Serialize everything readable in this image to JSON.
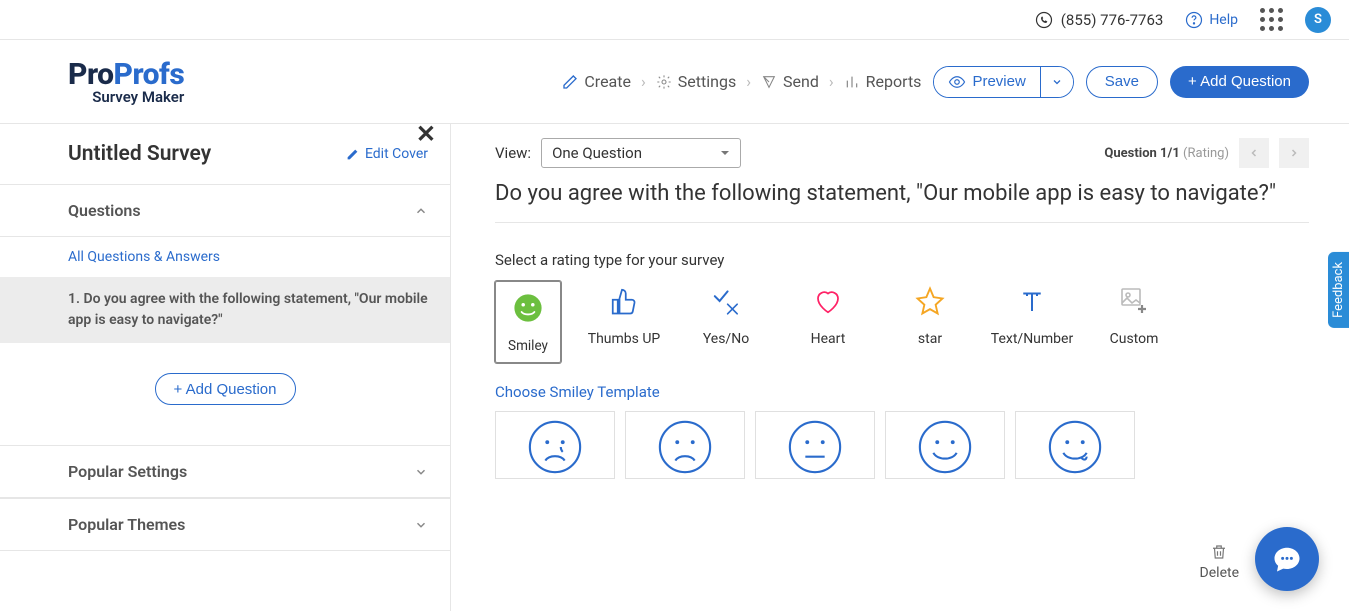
{
  "topbar": {
    "phone": "(855) 776-7763",
    "help": "Help",
    "avatar_letter": "S"
  },
  "logo": {
    "pro": "Pro",
    "profs": "Profs",
    "subtitle": "Survey Maker"
  },
  "nav": {
    "create": "Create",
    "settings": "Settings",
    "send": "Send",
    "reports": "Reports",
    "preview": "Preview",
    "save": "Save",
    "add_question": "+ Add Question"
  },
  "sidebar": {
    "survey_title": "Untitled Survey",
    "edit_cover": "Edit Cover",
    "sections": {
      "questions": "Questions",
      "popular_settings": "Popular Settings",
      "popular_themes": "Popular Themes"
    },
    "all_questions_link": "All Questions & Answers",
    "questions": [
      {
        "index": "1.",
        "text": "Do you agree with the following statement, \"Our mobile app is easy to navigate?\""
      }
    ],
    "add_question": "+ Add Question"
  },
  "main": {
    "view_label": "View:",
    "view_value": "One Question",
    "question_nav_label": "Question 1/1",
    "question_nav_type": "(Rating)",
    "question_title": "Do you agree with the following statement, \"Our mobile app is easy to navigate?\"",
    "rating_prompt": "Select a rating type for your survey",
    "rating_types": {
      "smiley": "Smiley",
      "thumbs": "Thumbs UP",
      "yesno": "Yes/No",
      "heart": "Heart",
      "star": "star",
      "textnum": "Text/Number",
      "custom": "Custom"
    },
    "choose_smiley": "Choose Smiley Template",
    "delete": "Delete"
  },
  "feedback": "Feedback"
}
